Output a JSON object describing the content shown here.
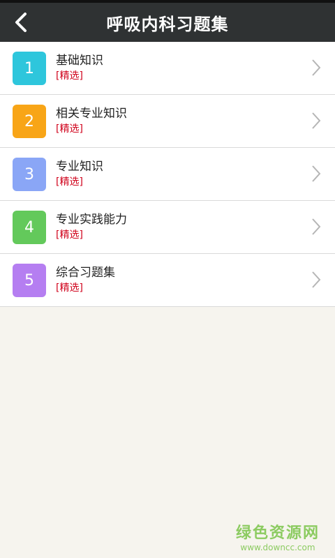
{
  "header": {
    "title": "呼吸内科习题集"
  },
  "items": [
    {
      "number": "1",
      "title": "基础知识",
      "tag": "[精选]",
      "color": "#2ec6dc"
    },
    {
      "number": "2",
      "title": "相关专业知识",
      "tag": "[精选]",
      "color": "#f8a517"
    },
    {
      "number": "3",
      "title": "专业知识",
      "tag": "[精选]",
      "color": "#8aa6f6"
    },
    {
      "number": "4",
      "title": "专业实践能力",
      "tag": "[精选]",
      "color": "#63c95b"
    },
    {
      "number": "5",
      "title": "综合习题集",
      "tag": "[精选]",
      "color": "#b57ef1"
    }
  ],
  "watermark": {
    "name": "绿色资源网",
    "url": "www.downcc.com"
  },
  "icons": {
    "back": "chevron-left-icon",
    "row_arrow": "chevron-right-icon"
  },
  "colors": {
    "header_bg": "#2f3233",
    "page_bg": "#f6f4ee",
    "tag_red": "#d0021b"
  }
}
